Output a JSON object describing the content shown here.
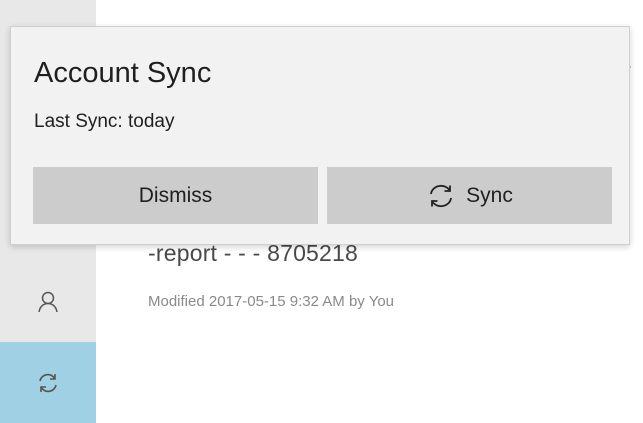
{
  "sidebar": {
    "items": [
      {
        "icon": "person-icon"
      },
      {
        "icon": "sync-icon",
        "active": true
      }
    ],
    "active_color": "#9fd0e3"
  },
  "content": {
    "fragment": "r",
    "file": {
      "title": "-report -  - - 8705218",
      "meta": "Modified 2017-05-15 9:32 AM by You"
    }
  },
  "popup": {
    "title": "Account Sync",
    "subtitle": "Last Sync: today",
    "dismiss_label": "Dismiss",
    "sync_label": "Sync",
    "sync_icon": "sync-icon"
  }
}
